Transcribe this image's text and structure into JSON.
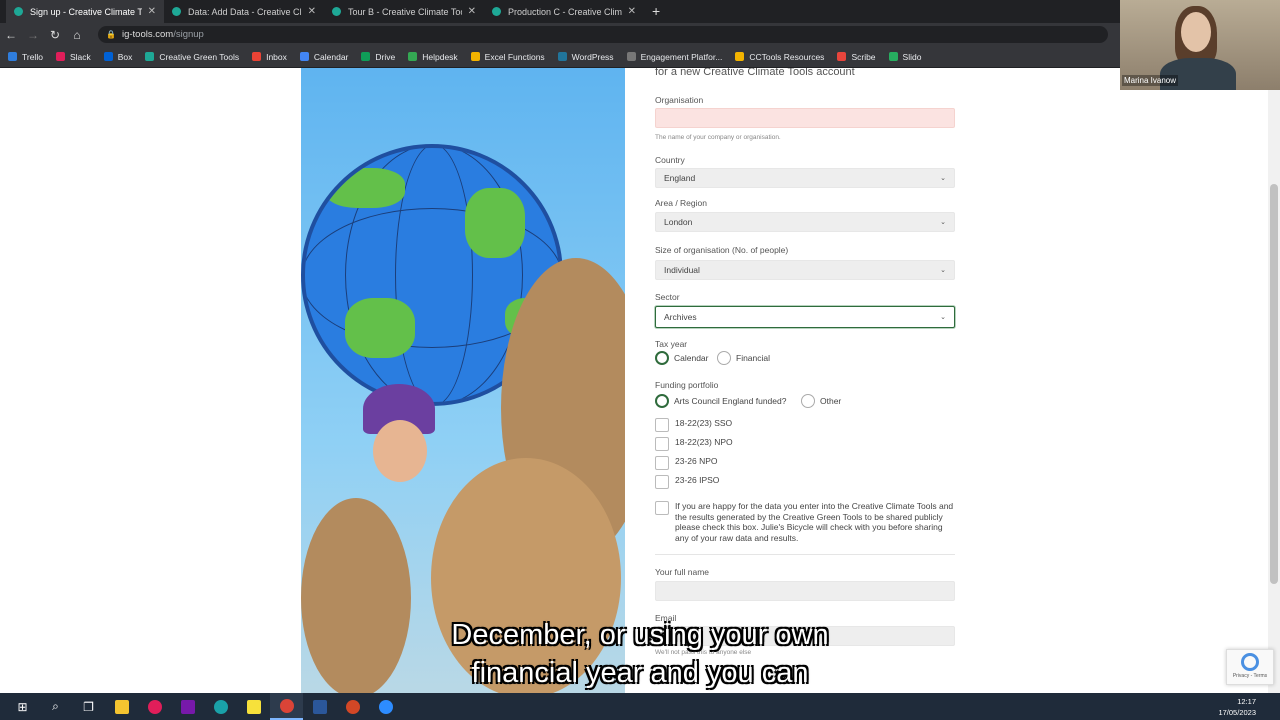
{
  "browser": {
    "tabs": [
      {
        "title": "Sign up - Creative Climate Tools",
        "active": true
      },
      {
        "title": "Data: Add Data - Creative Climat",
        "active": false
      },
      {
        "title": "Tour B - Creative Climate Tools",
        "active": false
      },
      {
        "title": "Production C - Creative Climate T",
        "active": false
      }
    ],
    "new_tab_glyph": "+",
    "url_host": "ig-tools.com",
    "url_path": "/signup",
    "bookmarks": [
      "Trello",
      "Slack",
      "Box",
      "Creative Green Tools",
      "Inbox",
      "Calendar",
      "Drive",
      "Helpdesk",
      "Excel Functions",
      "WordPress",
      "Engagement Platfor...",
      "CCTools Resources",
      "Scribe",
      "Slido"
    ],
    "bookmark_colors": [
      "#2f7ddc",
      "#e01e5a",
      "#0061d5",
      "#1ea896",
      "#ea4335",
      "#4285f4",
      "#0f9d58",
      "#34a853",
      "#f4b400",
      "#21759b",
      "#777777",
      "#f4b400",
      "#e8453c",
      "#27ae60"
    ]
  },
  "webcam": {
    "name": "Marina Ivanow"
  },
  "form": {
    "intro": "for a new Creative Climate Tools account",
    "organisation": {
      "label": "Organisation",
      "value": "",
      "help": "The name of your company or organisation."
    },
    "country": {
      "label": "Country",
      "value": "England"
    },
    "region": {
      "label": "Area / Region",
      "value": "London"
    },
    "size": {
      "label": "Size of organisation (No. of people)",
      "value": "Individual"
    },
    "sector": {
      "label": "Sector",
      "value": "Archives"
    },
    "tax_year": {
      "label": "Tax year",
      "options": [
        "Calendar",
        "Financial"
      ],
      "selected": "Calendar"
    },
    "funding": {
      "label": "Funding portfolio",
      "options": [
        "Arts Council England funded?",
        "Other"
      ],
      "selected": "Arts Council England funded?"
    },
    "portfolio_checks": [
      "18-22(23) SSO",
      "18-22(23) NPO",
      "23-26 NPO",
      "23-26 IPSO"
    ],
    "consent": "If you are happy for the data you enter into the Creative Climate Tools and the results generated by the Creative Green Tools to be shared publicly please check this box. Julie's Bicycle will check with you before sharing any of your raw data and results.",
    "full_name": {
      "label": "Your full name",
      "value": ""
    },
    "email": {
      "label": "Email",
      "help": "We'll not pass this to anyone else"
    }
  },
  "caption": {
    "line1": "December, or using your own",
    "line2": "financial year and you can"
  },
  "recaptcha": {
    "text": "Privacy - Terms"
  },
  "taskbar": {
    "time": "12:17",
    "date": "17/05/2023"
  },
  "colors": {
    "accent_green": "#2f6b3c",
    "error_pink": "#fbe3e1",
    "globe_blue": "#2a7de0",
    "land_green": "#63c04a"
  }
}
